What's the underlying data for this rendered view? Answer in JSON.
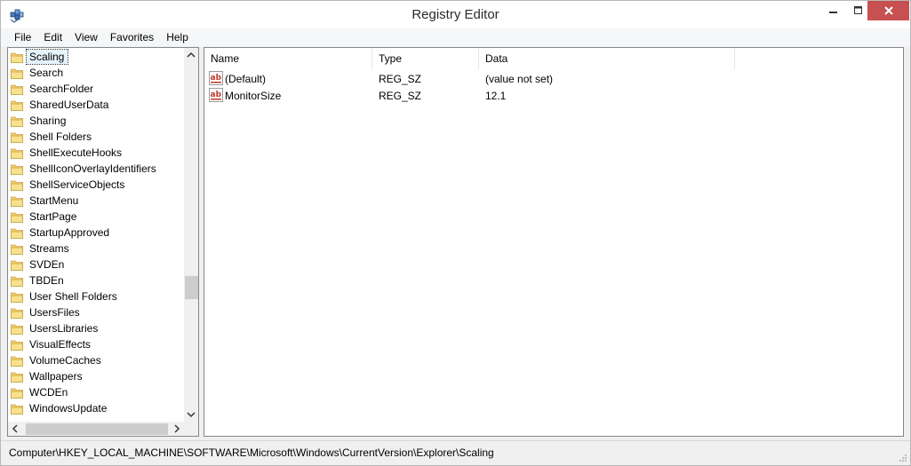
{
  "window": {
    "title": "Registry Editor",
    "accent_close": "#c75050"
  },
  "menubar": {
    "items": [
      "File",
      "Edit",
      "View",
      "Favorites",
      "Help"
    ]
  },
  "tree": {
    "selected": "Scaling",
    "items": [
      "Scaling",
      "Search",
      "SearchFolder",
      "SharedUserData",
      "Sharing",
      "Shell Folders",
      "ShellExecuteHooks",
      "ShellIconOverlayIdentifiers",
      "ShellServiceObjects",
      "StartMenu",
      "StartPage",
      "StartupApproved",
      "Streams",
      "SVDEn",
      "TBDEn",
      "User Shell Folders",
      "UsersFiles",
      "UsersLibraries",
      "VisualEffects",
      "VolumeCaches",
      "Wallpapers",
      "WCDEn",
      "WindowsUpdate"
    ]
  },
  "list": {
    "headers": {
      "name": "Name",
      "type": "Type",
      "data": "Data"
    },
    "rows": [
      {
        "name": "(Default)",
        "type": "REG_SZ",
        "data": "(value not set)"
      },
      {
        "name": "MonitorSize",
        "type": "REG_SZ",
        "data": "12.1"
      }
    ]
  },
  "statusbar": {
    "path": "Computer\\HKEY_LOCAL_MACHINE\\SOFTWARE\\Microsoft\\Windows\\CurrentVersion\\Explorer\\Scaling"
  }
}
